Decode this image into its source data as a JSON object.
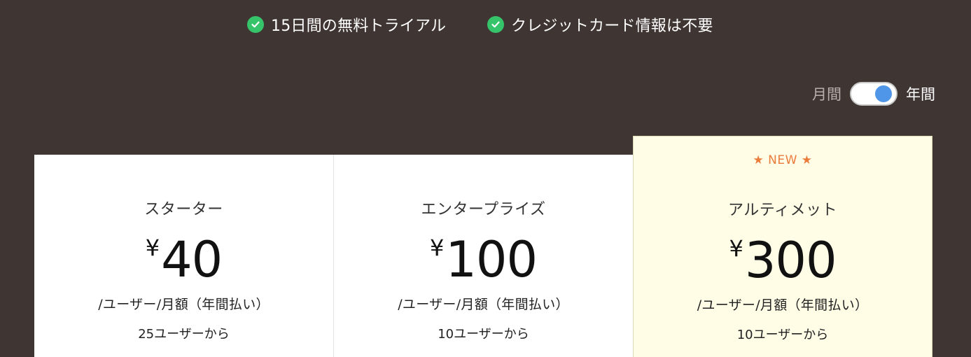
{
  "benefits": [
    {
      "icon": "check-circle-icon",
      "text": "15日間の無料トライアル"
    },
    {
      "icon": "check-circle-icon",
      "text": "クレジットカード情報は不要"
    }
  ],
  "billing_toggle": {
    "monthly_label": "月間",
    "yearly_label": "年間",
    "selected": "年間"
  },
  "plans": [
    {
      "name": "スターター",
      "currency": "¥",
      "price": "40",
      "per": "/ユーザー/月額（年間払い）",
      "min_users": "25ユーザーから"
    },
    {
      "name": "エンタープライズ",
      "currency": "¥",
      "price": "100",
      "per": "/ユーザー/月額（年間払い）",
      "min_users": "10ユーザーから"
    },
    {
      "badge": "★ NEW ★",
      "name": "アルティメット",
      "currency": "¥",
      "price": "300",
      "per": "/ユーザー/月額（年間払い）",
      "min_users": "10ユーザーから"
    }
  ],
  "colors": {
    "background": "#3f3532",
    "check_green": "#35c46a",
    "toggle_knob": "#4f95e8",
    "highlight_card": "#fffde6",
    "badge_orange": "#ea7c3c"
  }
}
